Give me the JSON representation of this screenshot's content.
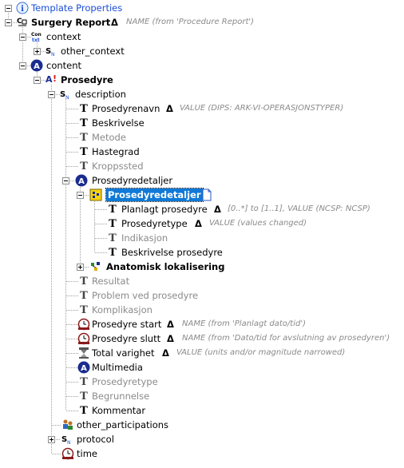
{
  "tree": {
    "root": "Template Properties",
    "surgery_report": "Surgery Report",
    "surgery_report_note": "NAME (from 'Procedure Report')",
    "context": "context",
    "other_context": "other_context",
    "content": "content",
    "prosedyre": "Prosedyre",
    "description": "description",
    "prosedyrenavn": "Prosedyrenavn",
    "prosedyrenavn_note": "VALUE (DIPS: ARK-VI-OPERASJONSTYPER)",
    "beskrivelse": "Beskrivelse",
    "metode": "Metode",
    "hastegrad": "Hastegrad",
    "kroppssted": "Kroppssted",
    "prosedyredetaljer_cluster": "Prosedyredetaljer",
    "prosedyredetaljer_selected": "Prosedyredetaljer",
    "planlagt_prosedyre": "Planlagt prosedyre",
    "planlagt_prosedyre_note": "[0..*] to [1..1], VALUE (NCSP: NCSP)",
    "prosedyretype_inner": "Prosedyretype",
    "prosedyretype_inner_note": "VALUE (values changed)",
    "indikasjon": "Indikasjon",
    "beskrivelse_prosedyre": "Beskrivelse prosedyre",
    "anatomisk": "Anatomisk lokalisering",
    "resultat": "Resultat",
    "problem": "Problem ved prosedyre",
    "komplikasjon": "Komplikasjon",
    "prosedyre_start": "Prosedyre start",
    "prosedyre_start_note": "NAME (from 'Planlagt dato/tid')",
    "prosedyre_slutt": "Prosedyre slutt",
    "prosedyre_slutt_note": "NAME (from 'Dato/tid for avslutning av prosedyren')",
    "total_varighet": "Total varighet",
    "total_varighet_note": "VALUE (units and/or magnitude narrowed)",
    "multimedia": "Multimedia",
    "prosedyretype_outer": "Prosedyretype",
    "begrunnelse": "Begrunnelse",
    "kommentar": "Kommentar",
    "other_participations": "other_participations",
    "protocol": "protocol",
    "time": "time",
    "delta": "Δ"
  },
  "icons": {
    "info": "info-icon",
    "archetype": "archetype-icon",
    "context": "context-icon",
    "slot": "slot-icon",
    "attribute": "attribute-icon",
    "action": "action-icon",
    "text": "text-icon",
    "cluster": "cluster-icon",
    "datetime": "datetime-icon",
    "quantity": "quantity-icon",
    "note": "note-icon"
  },
  "colors": {
    "selection": "#0f79d8",
    "tree_line": "#a0a0a0",
    "greyed": "#8a8a8a",
    "link": "#1c4fd8"
  }
}
